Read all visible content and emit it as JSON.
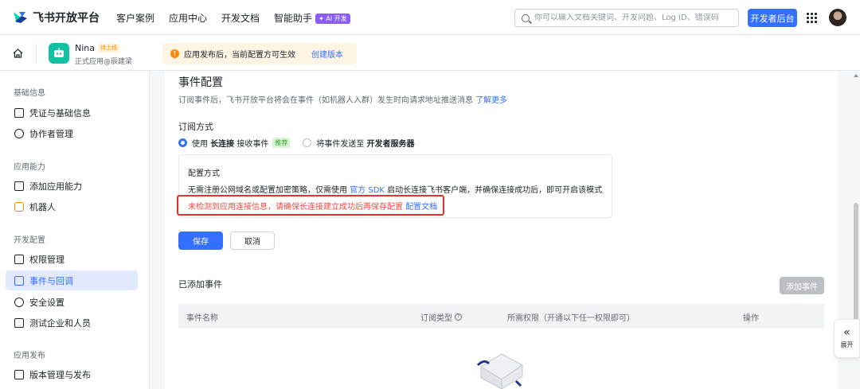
{
  "topbar": {
    "logo_text": "飞书开放平台",
    "nav": [
      "客户案例",
      "应用中心",
      "开发文档",
      "智能助手"
    ],
    "ai_badge": "✦ AI 开发",
    "search_placeholder": "你可以输入文档关键词、开发问题、Log ID、错误码",
    "dev_console_label": "开发者后台"
  },
  "appbar": {
    "app_name": "Nina",
    "app_status": "待上线",
    "app_sub": "正式应用@辰建梁",
    "notice_text": "应用发布后，当前配置方可生效",
    "notice_link": "创建版本"
  },
  "sidebar": {
    "groups": {
      "basic": "基础信息",
      "capability": "应用能力",
      "dev_config": "开发配置",
      "release": "应用发布"
    },
    "items": {
      "credentials": "凭证与基础信息",
      "collaborators": "协作者管理",
      "add_capability": "添加应用能力",
      "robot": "机器人",
      "permissions": "权限管理",
      "events": "事件与回调",
      "security": "安全设置",
      "test_enterprise": "测试企业和人员",
      "version": "版本管理与发布"
    }
  },
  "main": {
    "title": "事件配置",
    "desc": "订阅事件后，飞书开放平台将会在事件（如机器人入群）发生时向请求地址推送消息",
    "desc_link": "了解更多",
    "subscribe_title": "订阅方式",
    "option1_prefix": "使用",
    "option1_bold": "长连接",
    "option1_suffix": "接收事件",
    "option1_badge": "推荐",
    "option2_prefix": "将事件发送至",
    "option2_bold": "开发者服务器",
    "config_title": "配置方式",
    "config_desc_1": "无需注册公网域名或配置加密策略，仅需使用",
    "config_desc_link": "官方 SDK",
    "config_desc_2": "启动长连接飞书客户端，并确保连接成功后，即可开启该模式",
    "error_text": "未检测到应用连接信息，请确保长连接建立成功后再保存配置",
    "error_link": "配置文档",
    "save_label": "保存",
    "cancel_label": "取消",
    "added_title": "已添加事件",
    "add_event_label": "添加事件",
    "table_headers": [
      "事件名称",
      "订阅类型",
      "所需权限（开通以下任一权限即可）",
      "操作"
    ]
  },
  "expand_label": "展开",
  "colors": {
    "primary": "#3370ff",
    "error": "#f54a45",
    "warning": "#ff8800",
    "success": "#2ea121"
  }
}
